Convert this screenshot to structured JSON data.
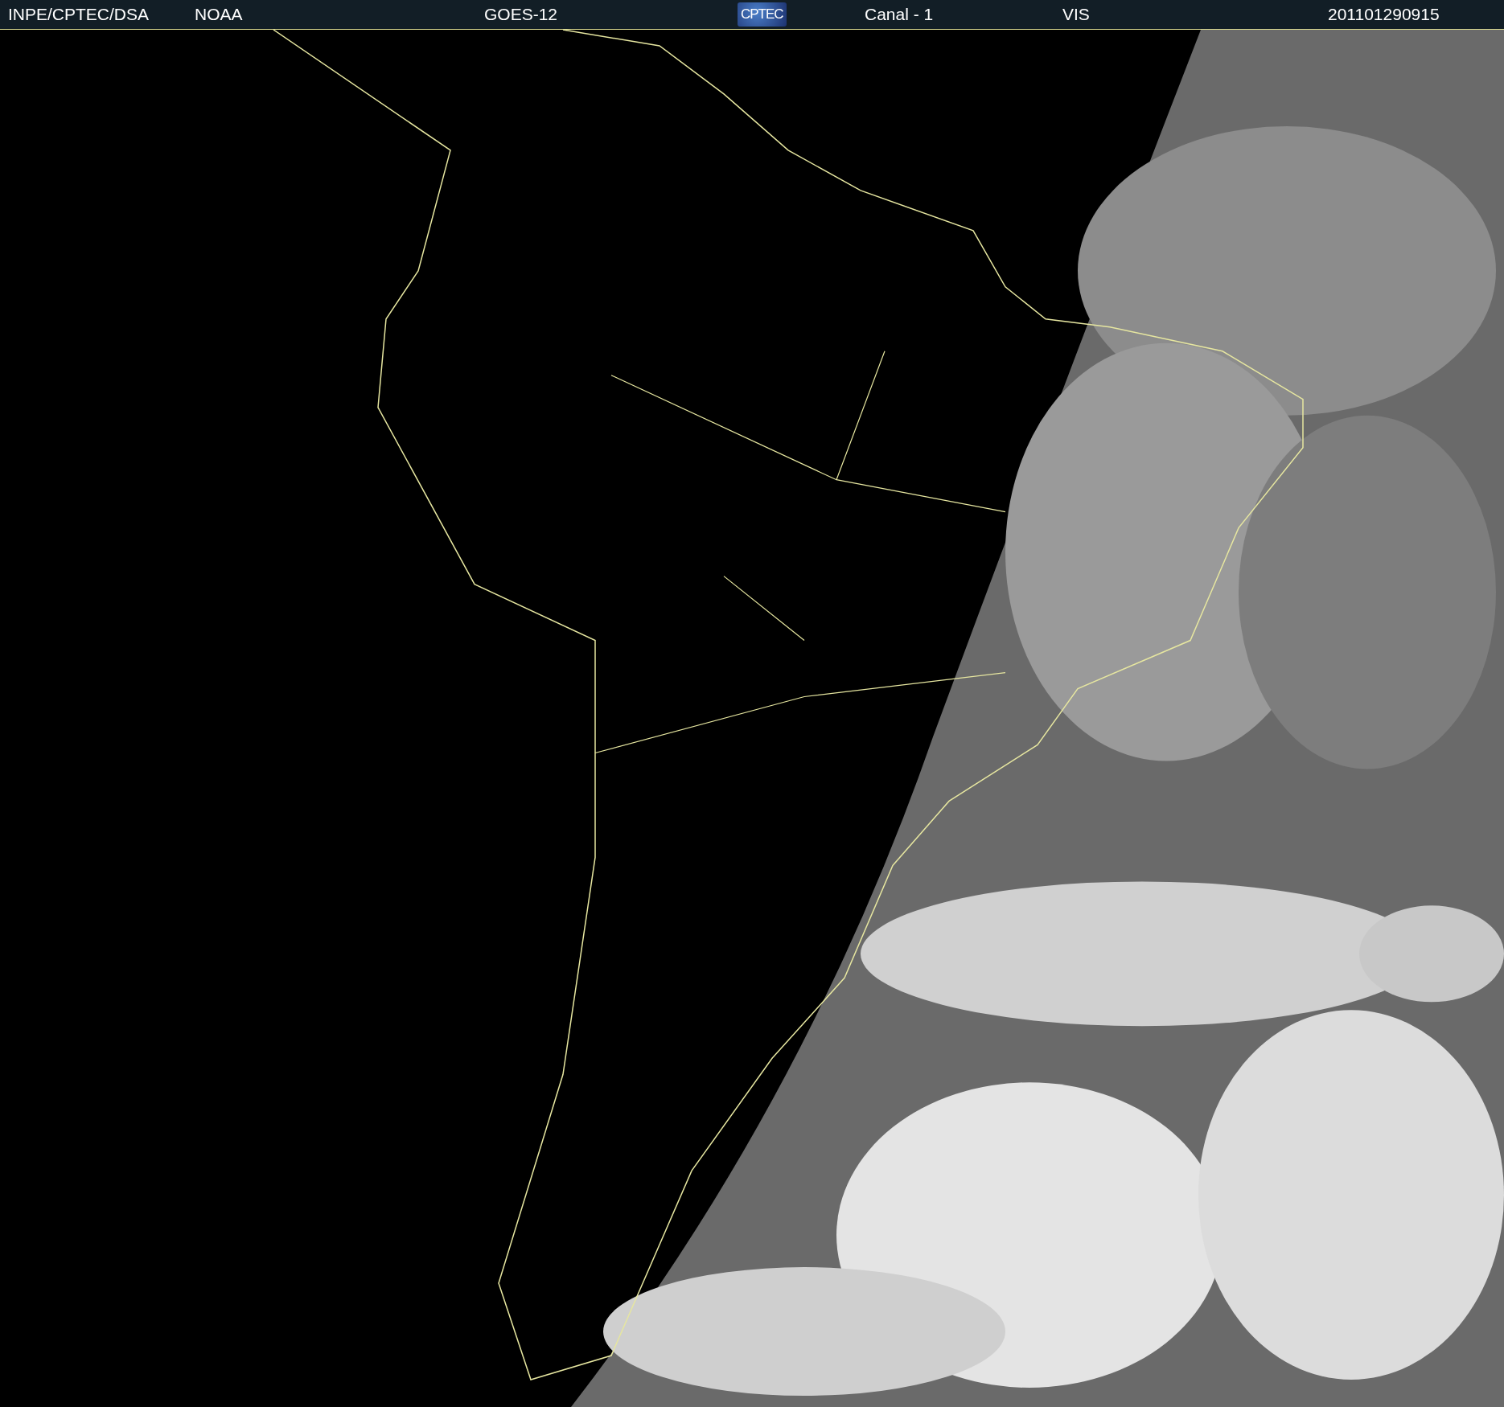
{
  "header": {
    "texts": [
      {
        "text": "INPE/CPTEC/DSA"
      },
      {
        "text": "NOAA"
      },
      {
        "text": "GOES-12"
      },
      {
        "logo": "CPTEC"
      },
      {
        "text": "Canal - 1"
      },
      {
        "text": "VIS"
      },
      {
        "text": "201101290915"
      }
    ]
  }
}
